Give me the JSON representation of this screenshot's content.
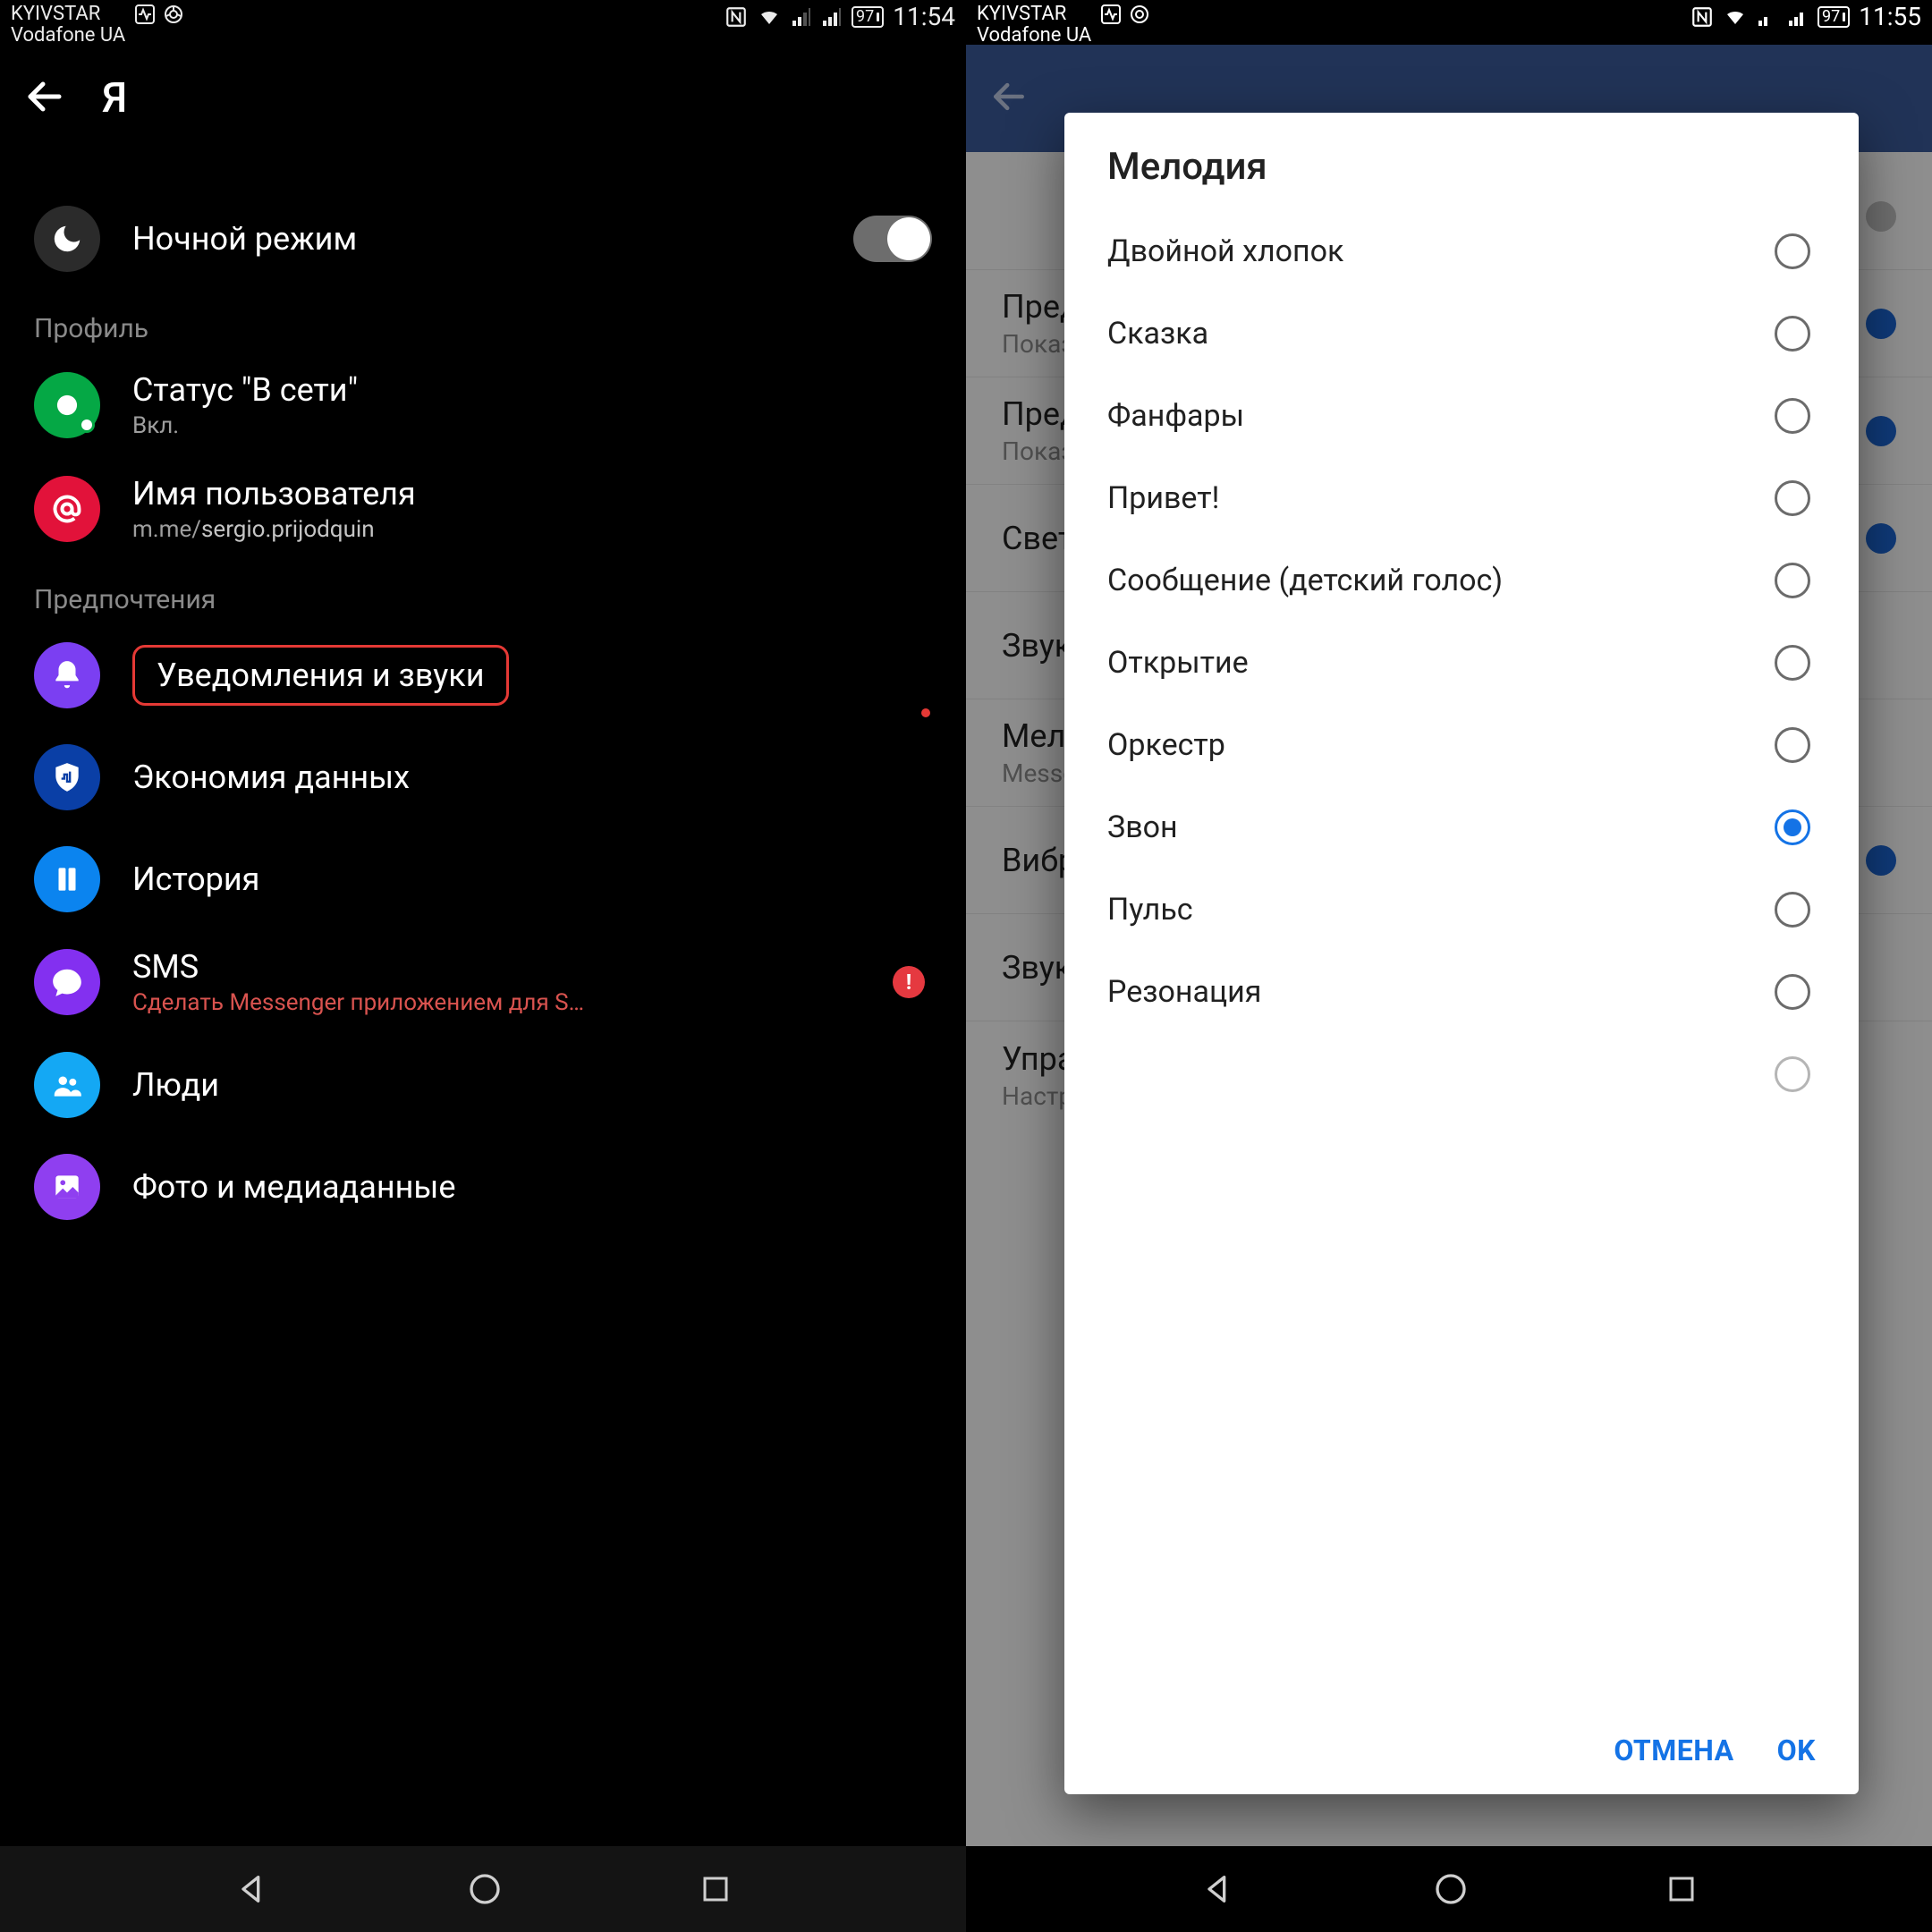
{
  "left": {
    "statusbar": {
      "carrier1": "KYIVSTAR",
      "carrier2": "Vodafone UA",
      "battery": "97",
      "time": "11:54"
    },
    "header": {
      "title": "Я"
    },
    "night_mode": {
      "label": "Ночной режим"
    },
    "section_profile": "Профиль",
    "status_row": {
      "title": "Статус \"В сети\"",
      "sub": "Вкл."
    },
    "username_row": {
      "title": "Имя пользователя",
      "sub_prefix": "m.me/",
      "sub_user": "sergio.prijodquin"
    },
    "section_prefs": "Предпочтения",
    "notif_row": "Уведомления и звуки",
    "data_row": "Экономия данных",
    "history_row": "История",
    "sms_row": {
      "title": "SMS",
      "sub": "Сделать Messenger приложением для S…",
      "badge": "!"
    },
    "people_row": "Люди",
    "media_row": "Фото и медиаданные"
  },
  "right": {
    "statusbar": {
      "carrier1": "KYIVSTAR",
      "carrier2": "Vodafone UA",
      "battery": "97",
      "time": "11:55"
    },
    "bg": {
      "rows": [
        {
          "t1": "",
          "t2": ""
        },
        {
          "t1": "Предварительный просмотр уведомлений",
          "t2": "Показывать"
        },
        {
          "t1": "Предварительный просмотр push-уведомлений",
          "t2": "Показывать"
        },
        {
          "t1": "Свет",
          "t2": ""
        },
        {
          "t1": "Звук",
          "t2": ""
        },
        {
          "t1": "Мелодия",
          "t2": "Messenger"
        },
        {
          "t1": "Вибрация при входящем вызове",
          "t2": ""
        },
        {
          "t1": "Звук",
          "t2": ""
        },
        {
          "t1": "Управление уведомлениями",
          "t2": "Настройки важности, звуков и вибрации"
        }
      ]
    },
    "dialog": {
      "title": "Мелодия",
      "options": [
        "Двойной хлопок",
        "Сказка",
        "Фанфары",
        "Привет!",
        "Сообщение (детский голос)",
        "Открытие",
        "Оркестр",
        "Звон",
        "Пульс",
        "Резонация"
      ],
      "selected_index": 7,
      "cancel": "ОТМЕНА",
      "ok": "OK"
    }
  }
}
